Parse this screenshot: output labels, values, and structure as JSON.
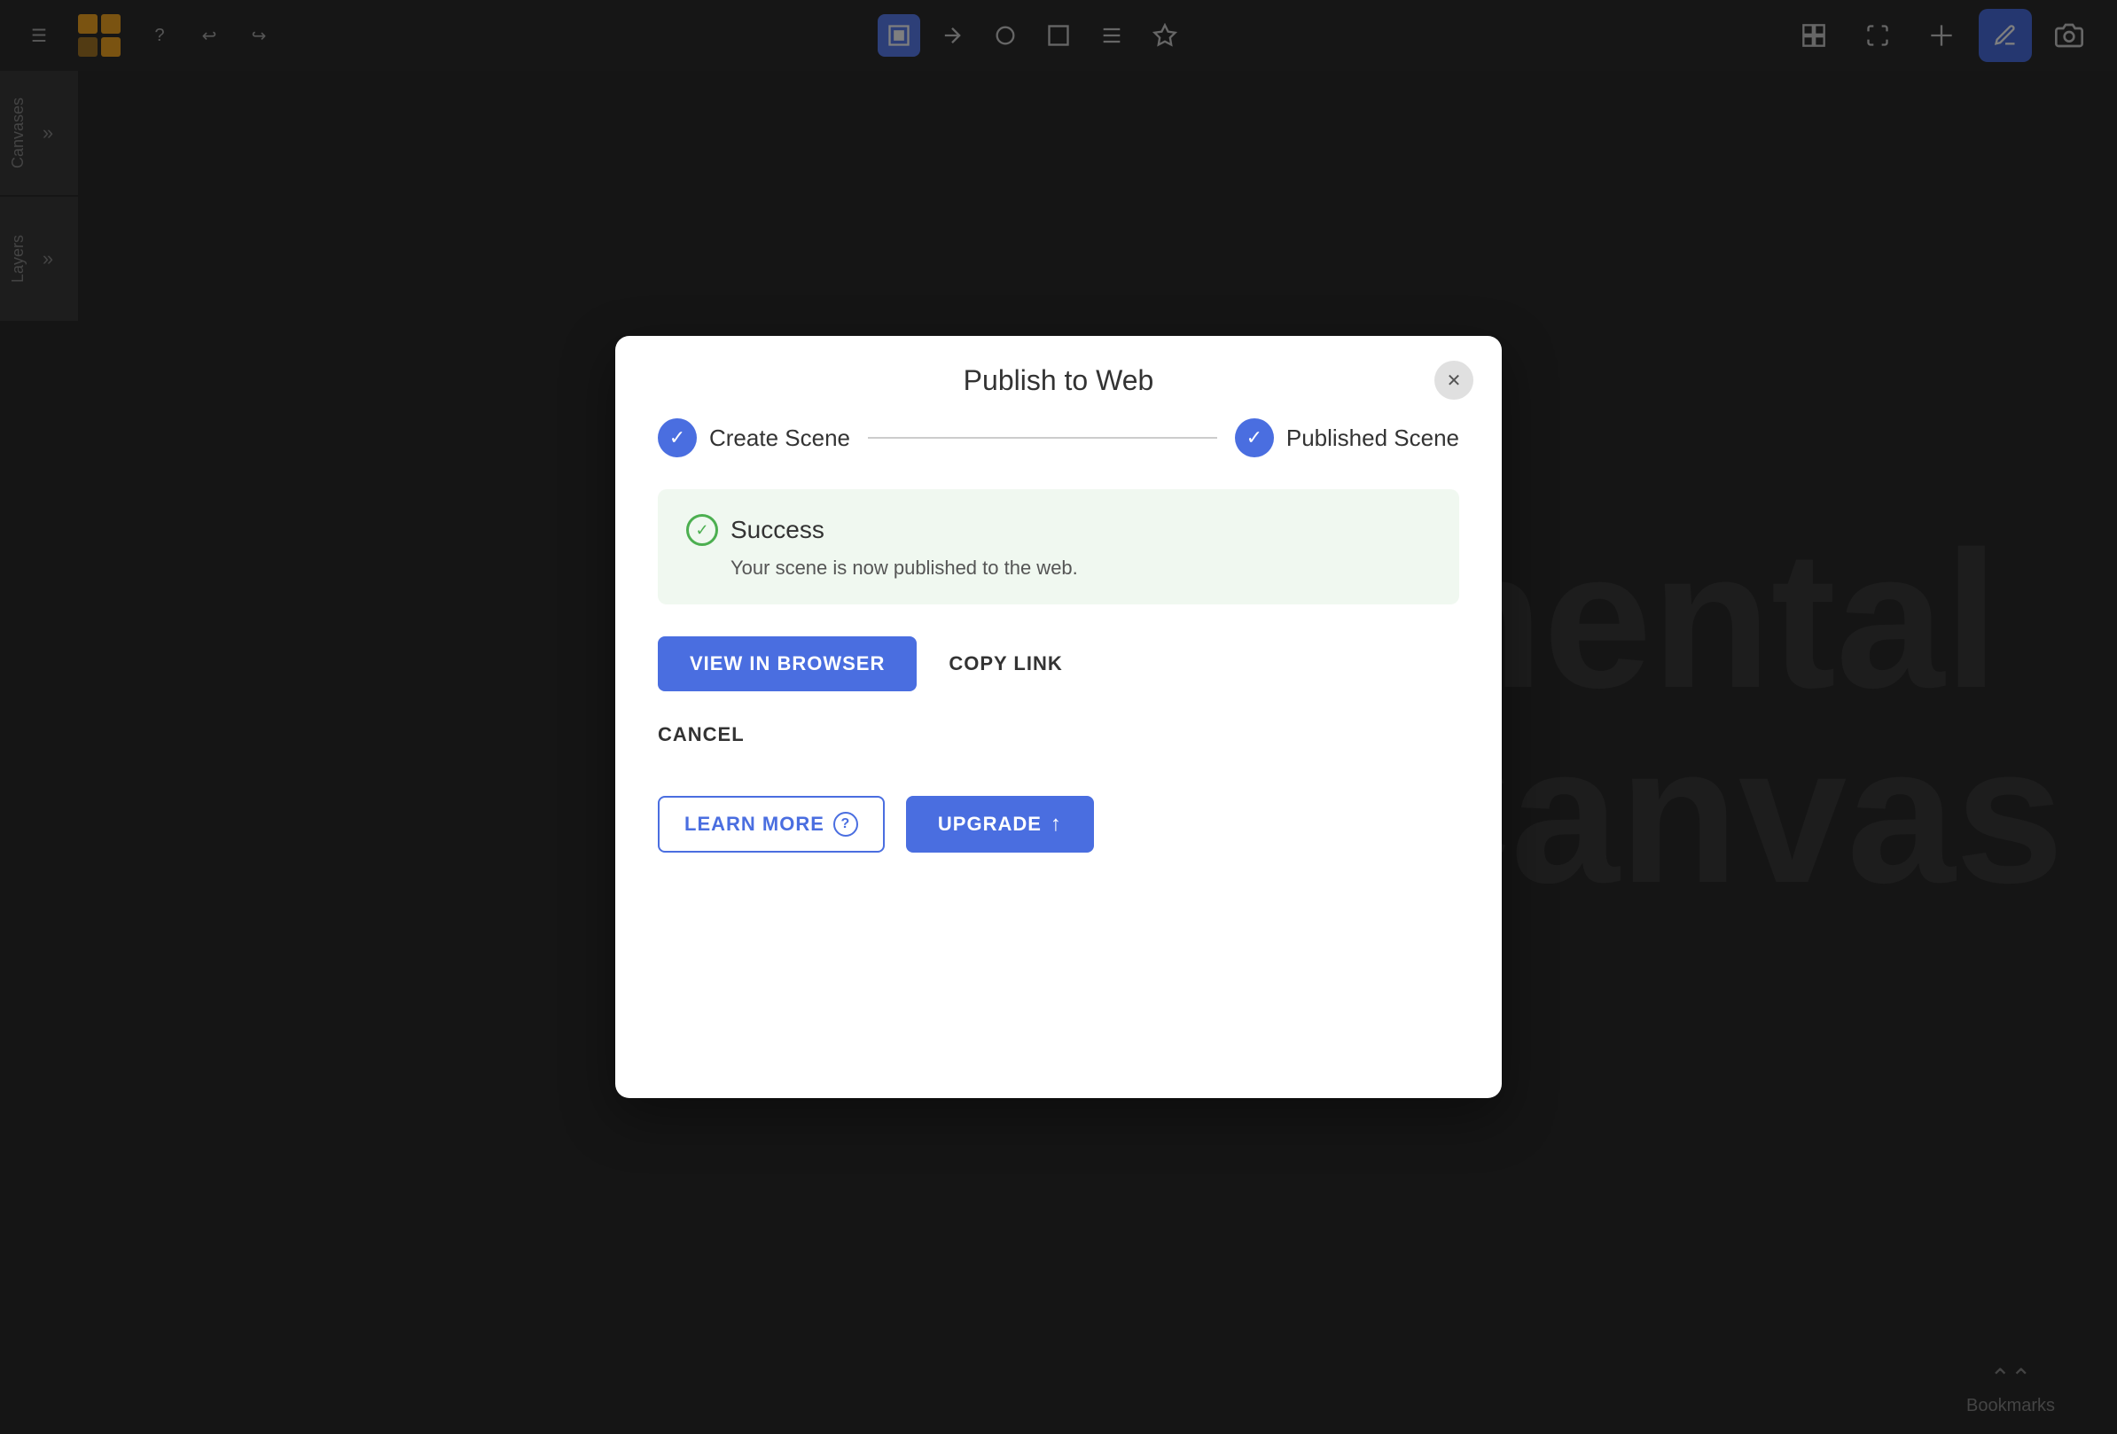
{
  "app": {
    "title": "Publish to Web"
  },
  "toolbar": {
    "undo_label": "↩",
    "redo_label": "↪",
    "help_label": "?",
    "menu_label": "☰",
    "camera_label": "📷",
    "pen_label": "✏️"
  },
  "sidebar": {
    "canvases_label": "Canvases",
    "layers_label": "Layers",
    "chevron": "»"
  },
  "canvas": {
    "bg_text_line1": "mental",
    "bg_text_line2": "Canvas"
  },
  "modal": {
    "title": "Publish to Web",
    "close_label": "✕",
    "steps": [
      {
        "label": "Create Scene",
        "completed": true
      },
      {
        "label": "Published Scene",
        "completed": true
      }
    ],
    "success": {
      "title": "Success",
      "description": "Your scene is now published to the web."
    },
    "view_in_browser_label": "VIEW IN BROWSER",
    "copy_link_label": "COPY LINK",
    "cancel_label": "CANCEL",
    "learn_more_label": "LEARN MORE",
    "upgrade_label": "UPGRADE",
    "upgrade_icon": "↑"
  },
  "bookmarks": {
    "label": "Bookmarks",
    "icon": "⌃"
  },
  "colors": {
    "accent": "#4a6ee0",
    "success": "#4caf50",
    "success_bg": "#f0f8f0"
  }
}
